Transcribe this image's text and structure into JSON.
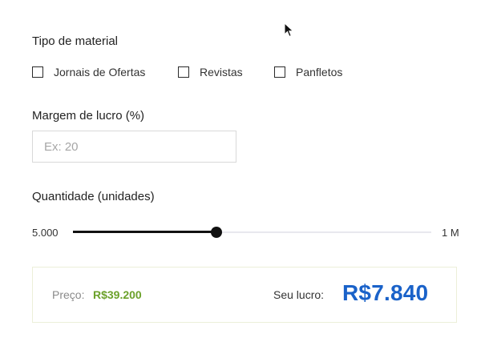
{
  "material": {
    "title": "Tipo de material",
    "options": [
      {
        "label": "Jornais de Ofertas",
        "checked": false
      },
      {
        "label": "Revistas",
        "checked": false
      },
      {
        "label": "Panfletos",
        "checked": false
      }
    ]
  },
  "margin": {
    "title": "Margem de lucro (%)",
    "placeholder": "Ex: 20",
    "value": ""
  },
  "quantity": {
    "title": "Quantidade (unidades)",
    "min_label": "5.000",
    "max_label": "1 M",
    "slider_fraction": 0.4
  },
  "result": {
    "price_label": "Preço:",
    "price_value": "R$39.200",
    "profit_label": "Seu lucro:",
    "profit_value": "R$7.840"
  },
  "colors": {
    "price": "#6ba12a",
    "profit": "#1a62c9",
    "slider": "#111111"
  },
  "icons": {
    "cursor": "arrow-cursor-icon"
  }
}
